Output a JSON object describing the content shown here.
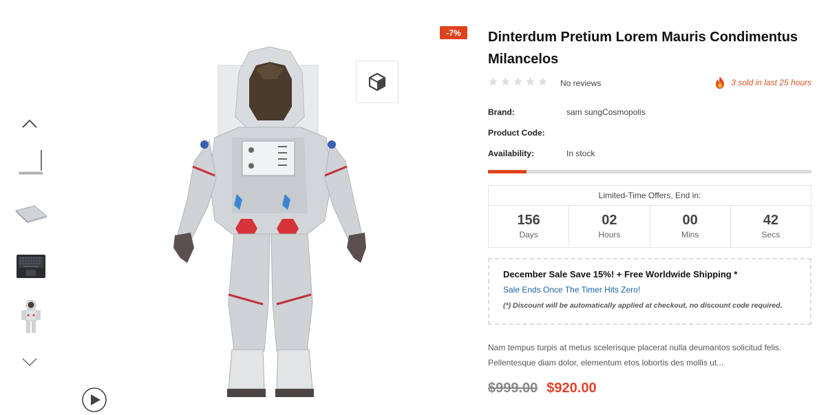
{
  "gallery": {
    "thumbnails": [
      "laptop-side",
      "laptop-closed",
      "laptop-open",
      "astronaut"
    ],
    "discount_badge": "-7%"
  },
  "product": {
    "title": "Dinterdum Pretium Lorem Mauris Condimentus Milancelos",
    "reviews": "No reviews",
    "rating": 0,
    "rating_max": 5,
    "sold": "3 sold in last 25 hours",
    "meta": [
      {
        "label": "Brand:",
        "value": "sam sungCosmopolis"
      },
      {
        "label": "Product Code:",
        "value": ""
      },
      {
        "label": "Availability:",
        "value": "In stock"
      }
    ],
    "stock_fraction": 0.12
  },
  "countdown": {
    "title": "Limited-Time Offers, End in:",
    "cells": [
      {
        "value": "156",
        "unit": "Days"
      },
      {
        "value": "02",
        "unit": "Hours"
      },
      {
        "value": "00",
        "unit": "Mins"
      },
      {
        "value": "42",
        "unit": "Secs"
      }
    ]
  },
  "promo": {
    "headline": "December Sale Save 15%! + Free Worldwide Shipping *",
    "subline": "Sale Ends Once The Timer Hits Zero!",
    "note": "(*) Discount will be automatically applied at checkout, no discount code required."
  },
  "description": [
    "Nam tempus turpis at metus scelerisque placerat nulla deumantos solicitud felis.",
    "Pellentesque diam dolor, elementum etos lobortis des mollis ut..."
  ],
  "price": {
    "old": "$999.00",
    "new": "$920.00"
  },
  "colors": {
    "accent": "#e0431c",
    "sale_price": "#e0432d",
    "link_blue": "#1e5fa8"
  },
  "icons": [
    "chevron-up-icon",
    "chevron-down-icon",
    "play-icon",
    "cube-3d-icon",
    "star-icon",
    "fire-icon"
  ]
}
